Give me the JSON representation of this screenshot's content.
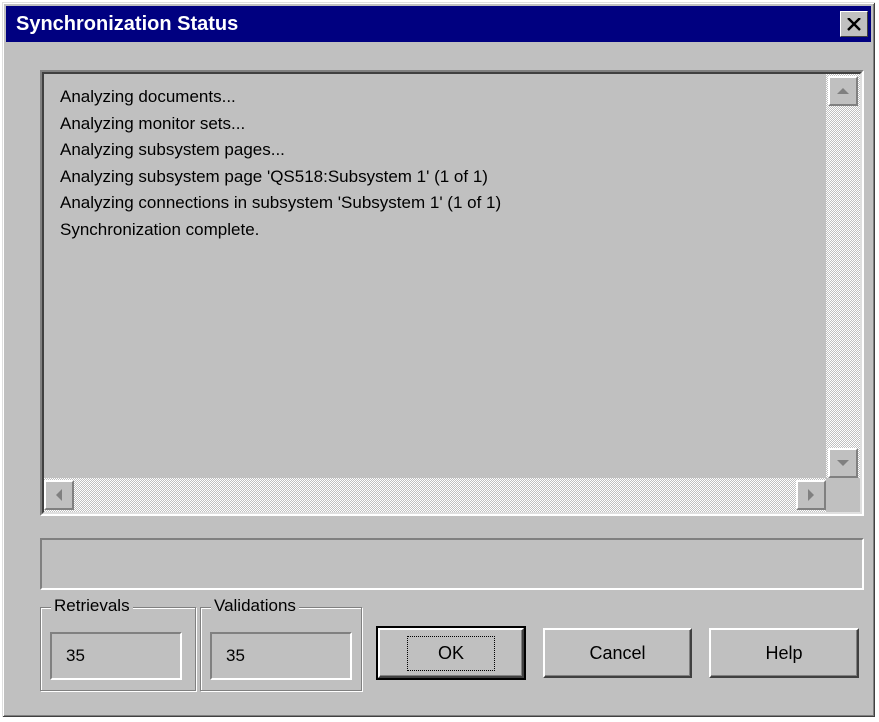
{
  "window": {
    "title": "Synchronization Status"
  },
  "log": {
    "lines": [
      "Analyzing documents...",
      "Analyzing monitor sets...",
      "Analyzing subsystem pages...",
      "Analyzing subsystem page 'QS518:Subsystem 1' (1 of 1)",
      "Analyzing connections in subsystem 'Subsystem 1' (1 of 1)",
      "Synchronization complete."
    ]
  },
  "progress": {
    "text": ""
  },
  "retrievals": {
    "label": "Retrievals",
    "value": "35"
  },
  "validations": {
    "label": "Validations",
    "value": "35"
  },
  "buttons": {
    "ok": "OK",
    "cancel": "Cancel",
    "help": "Help"
  },
  "icons": {
    "close": "close-icon",
    "scroll_up": "scroll-up-arrow-icon",
    "scroll_down": "scroll-down-arrow-icon",
    "scroll_left": "scroll-left-arrow-icon",
    "scroll_right": "scroll-right-arrow-icon"
  }
}
